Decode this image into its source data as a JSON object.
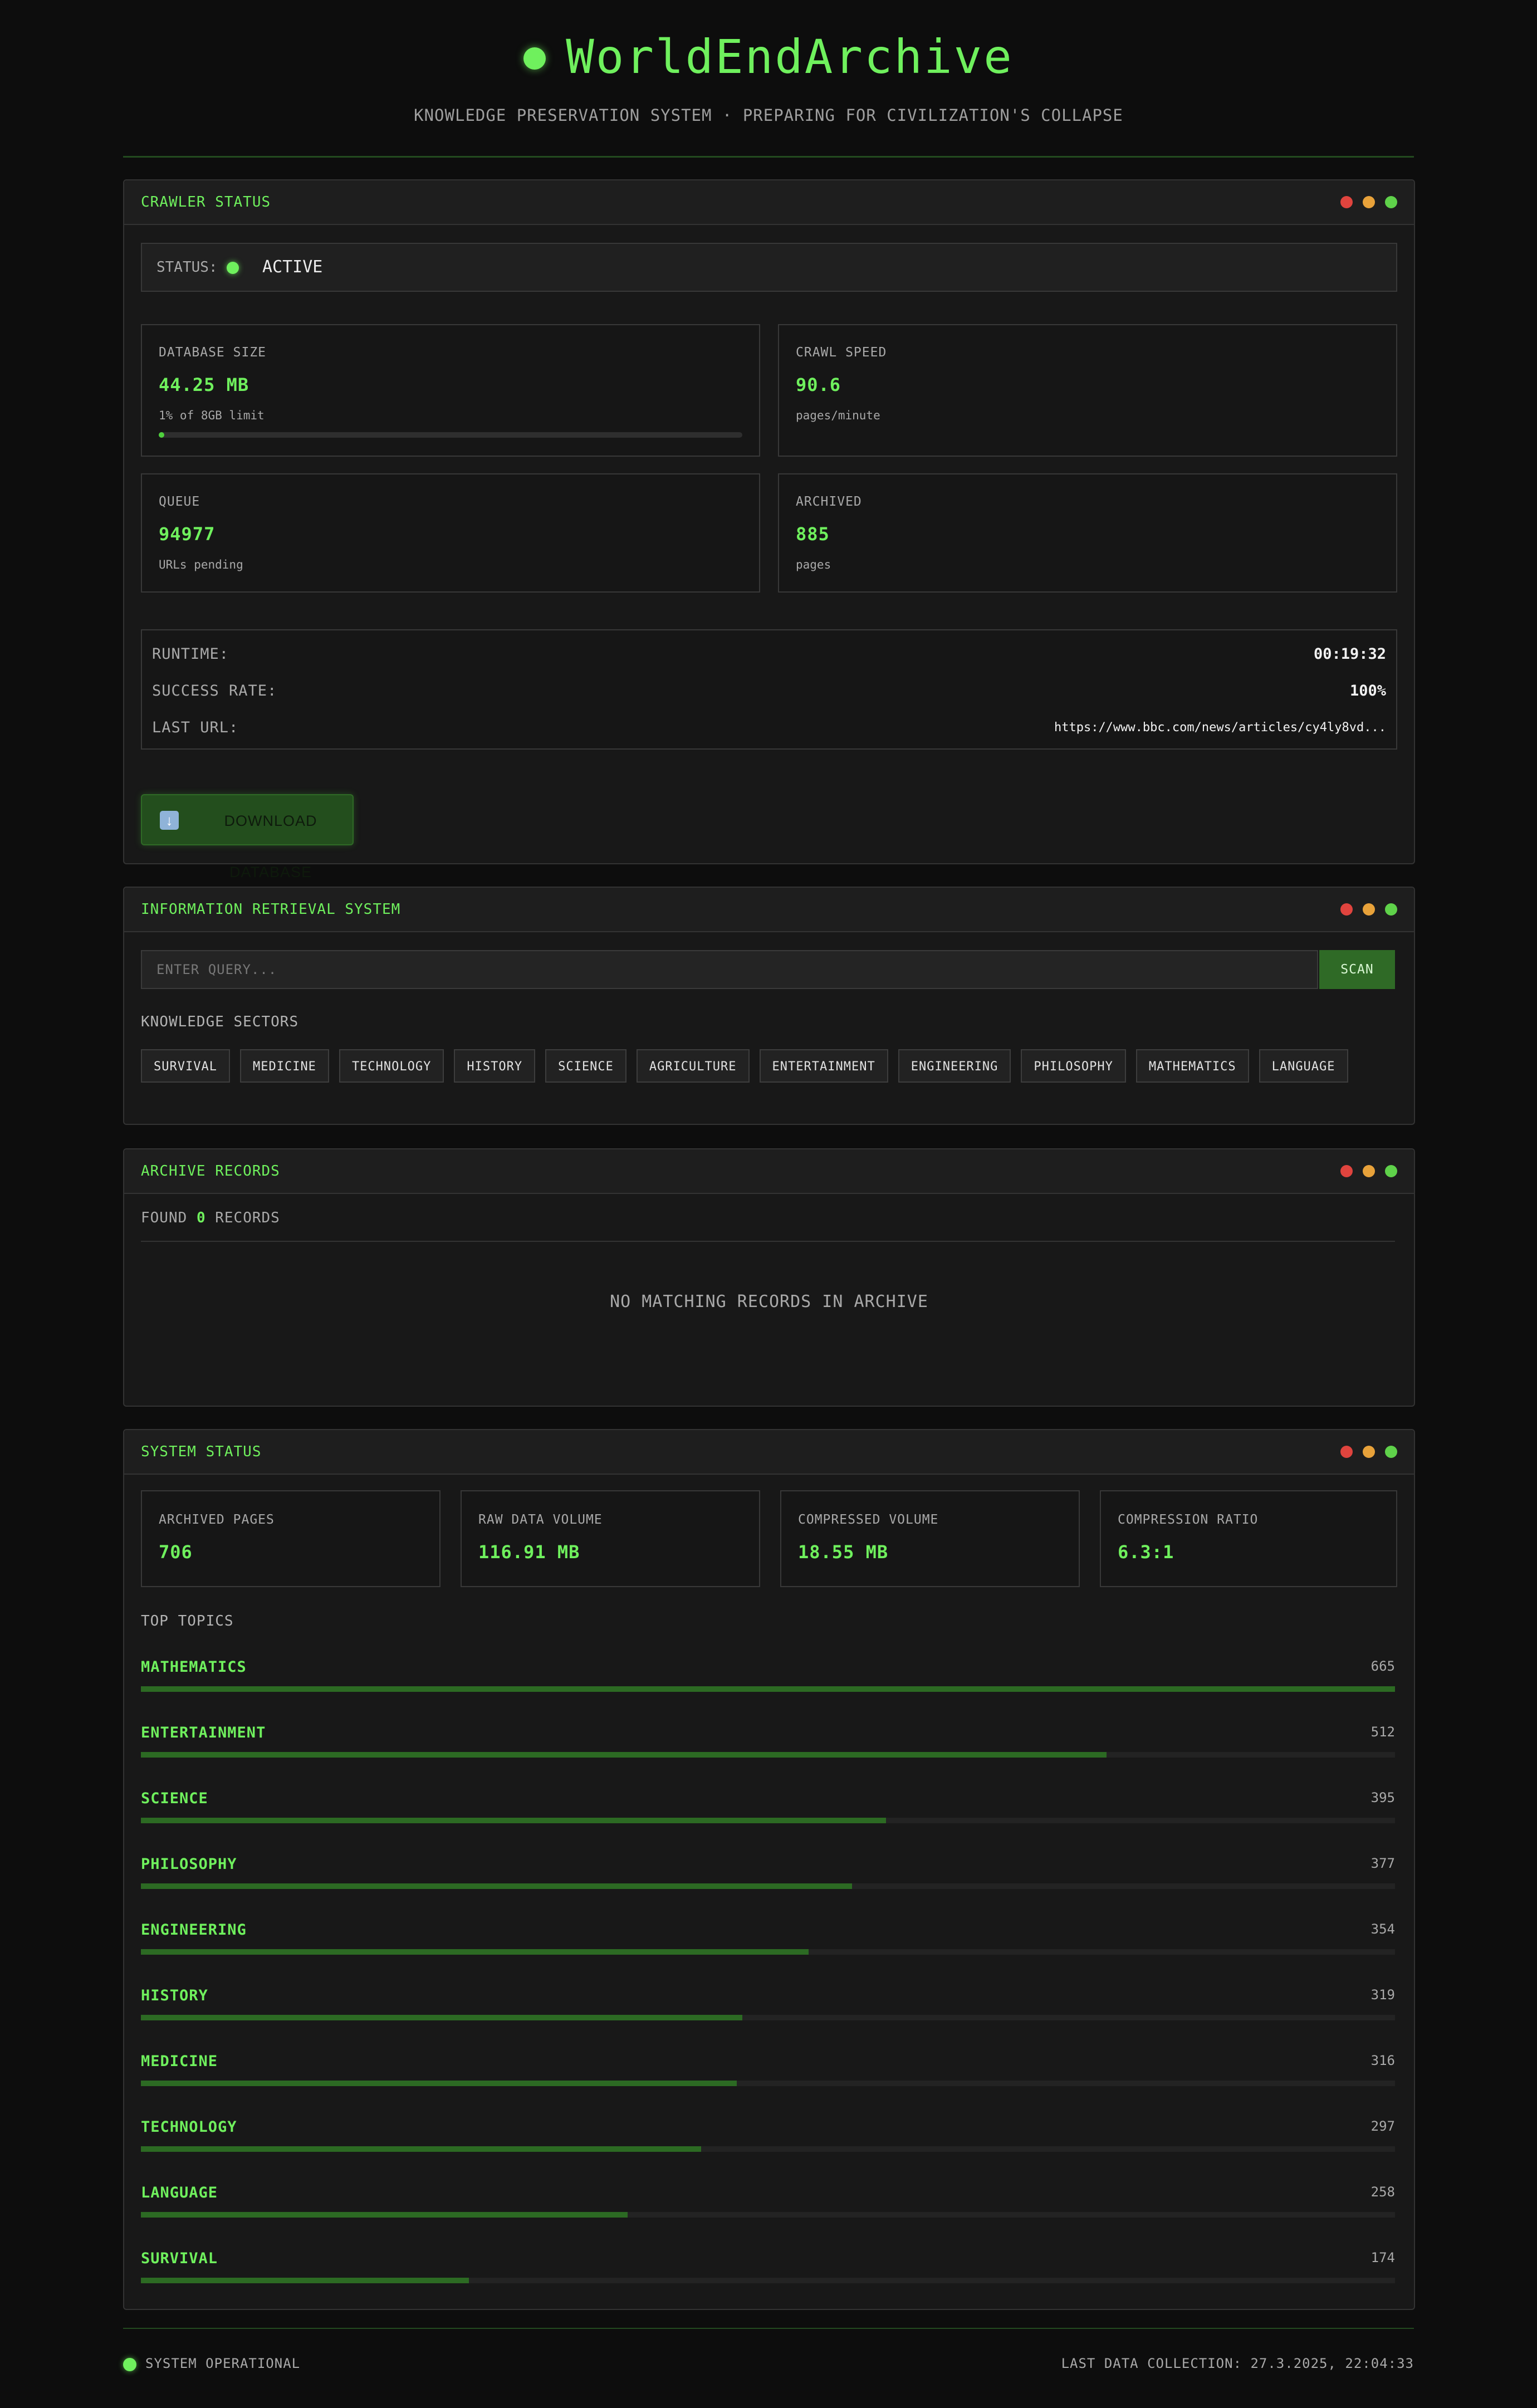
{
  "header": {
    "title": "WorldEndArchive",
    "subtitle": "KNOWLEDGE PRESERVATION SYSTEM · PREPARING FOR CIVILIZATION'S COLLAPSE"
  },
  "window_dot_colors": [
    "#e0443e",
    "#e8a23a",
    "#5fd24a"
  ],
  "crawler": {
    "title": "CRAWLER STATUS",
    "status_label": "STATUS:",
    "status_value": "ACTIVE",
    "cards": [
      {
        "label": "DATABASE SIZE",
        "value": "44.25 MB",
        "sub": "1% of 8GB limit",
        "progress": 0.01
      },
      {
        "label": "CRAWL SPEED",
        "value": "90.6",
        "sub": "pages/minute"
      },
      {
        "label": "QUEUE",
        "value": "94977",
        "sub": "URLs pending"
      },
      {
        "label": "ARCHIVED",
        "value": "885",
        "sub": "pages"
      }
    ],
    "info": {
      "runtime_label": "RUNTIME:",
      "runtime": "00:19:32",
      "success_label": "SUCCESS RATE:",
      "success": "100%",
      "url_label": "LAST URL:",
      "url": "https://www.bbc.com/news/articles/cy4ly8vd..."
    },
    "download_label": "DOWNLOAD DATABASE",
    "download_icon": "download-arrow-icon"
  },
  "retrieval": {
    "title": "INFORMATION RETRIEVAL SYSTEM",
    "search_placeholder": "ENTER QUERY...",
    "search_value": "",
    "scan_label": "SCAN",
    "sectors_label": "KNOWLEDGE SECTORS",
    "sectors": [
      "SURVIVAL",
      "MEDICINE",
      "TECHNOLOGY",
      "HISTORY",
      "SCIENCE",
      "AGRICULTURE",
      "ENTERTAINMENT",
      "ENGINEERING",
      "PHILOSOPHY",
      "MATHEMATICS",
      "LANGUAGE"
    ]
  },
  "records": {
    "title": "ARCHIVE RECORDS",
    "found_prefix": "FOUND",
    "found_count": "0",
    "found_suffix": "RECORDS",
    "empty_text": "NO MATCHING RECORDS IN ARCHIVE"
  },
  "system": {
    "title": "SYSTEM STATUS",
    "cards": [
      {
        "label": "ARCHIVED PAGES",
        "value": "706"
      },
      {
        "label": "RAW DATA VOLUME",
        "value": "116.91 MB"
      },
      {
        "label": "COMPRESSED VOLUME",
        "value": "18.55 MB"
      },
      {
        "label": "COMPRESSION RATIO",
        "value": "6.3:1"
      }
    ],
    "topics_label": "TOP TOPICS",
    "topics": [
      {
        "name": "MATHEMATICS",
        "count": 665
      },
      {
        "name": "ENTERTAINMENT",
        "count": 512
      },
      {
        "name": "SCIENCE",
        "count": 395
      },
      {
        "name": "PHILOSOPHY",
        "count": 377
      },
      {
        "name": "ENGINEERING",
        "count": 354
      },
      {
        "name": "HISTORY",
        "count": 319
      },
      {
        "name": "MEDICINE",
        "count": 316
      },
      {
        "name": "TECHNOLOGY",
        "count": 297
      },
      {
        "name": "LANGUAGE",
        "count": 258
      },
      {
        "name": "SURVIVAL",
        "count": 174
      }
    ]
  },
  "footer": {
    "status": "SYSTEM OPERATIONAL",
    "last_collection": "LAST DATA COLLECTION: 27.3.2025, 22:04:33"
  }
}
